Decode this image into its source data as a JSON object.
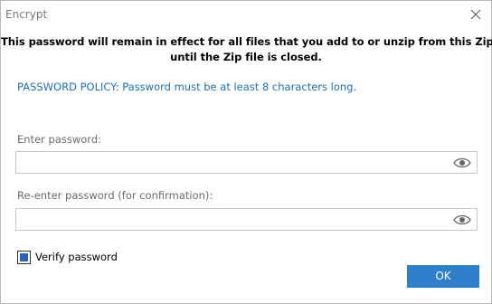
{
  "window": {
    "title": "Encrypt"
  },
  "notice": {
    "line1": "This password will remain in effect for all files that you add to or unzip from this Zip file",
    "line2": "until the Zip file is closed."
  },
  "policy": {
    "text": "PASSWORD POLICY: Password must be at least 8 characters long."
  },
  "password": {
    "label": "Enter password:",
    "value": "",
    "show_icon": "eye-icon"
  },
  "confirm_password": {
    "label": "Re-enter password (for confirmation):",
    "value": "",
    "show_icon": "eye-icon"
  },
  "verify": {
    "label": "Verify password",
    "checked": true
  },
  "buttons": {
    "ok_label": "OK"
  },
  "colors": {
    "policy_text": "#1f6fb5",
    "ok_button": "#2f7fcd",
    "checkbox_fill": "#2d62b8"
  }
}
